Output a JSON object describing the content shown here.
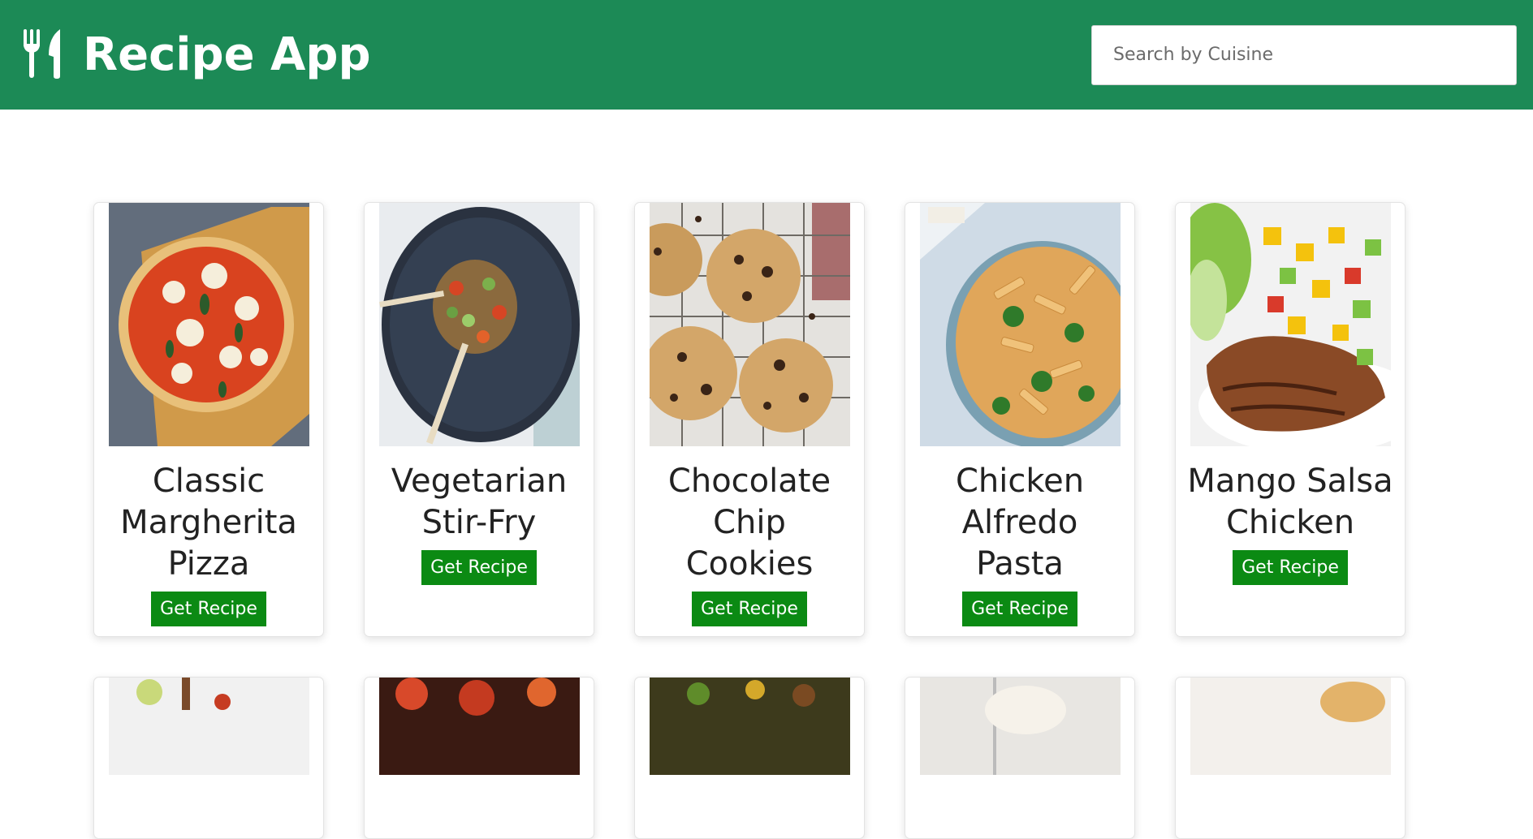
{
  "header": {
    "title": "Recipe App",
    "logo_icon": "fork-knife-icon",
    "bg_color": "#1c8a56"
  },
  "search": {
    "placeholder": "Search by Cuisine",
    "value": ""
  },
  "button_color": "#0b8a13",
  "recipes": [
    {
      "title": "Classic Margherita Pizza",
      "button": "Get Recipe",
      "image": "pizza-image"
    },
    {
      "title": "Vegetarian Stir-Fry",
      "button": "Get Recipe",
      "image": "stir-fry-image"
    },
    {
      "title": "Chocolate Chip Cookies",
      "button": "Get Recipe",
      "image": "cookies-image"
    },
    {
      "title": "Chicken Alfredo Pasta",
      "button": "Get Recipe",
      "image": "pasta-image"
    },
    {
      "title": "Mango Salsa Chicken",
      "button": "Get Recipe",
      "image": "mango-chicken-image"
    }
  ]
}
